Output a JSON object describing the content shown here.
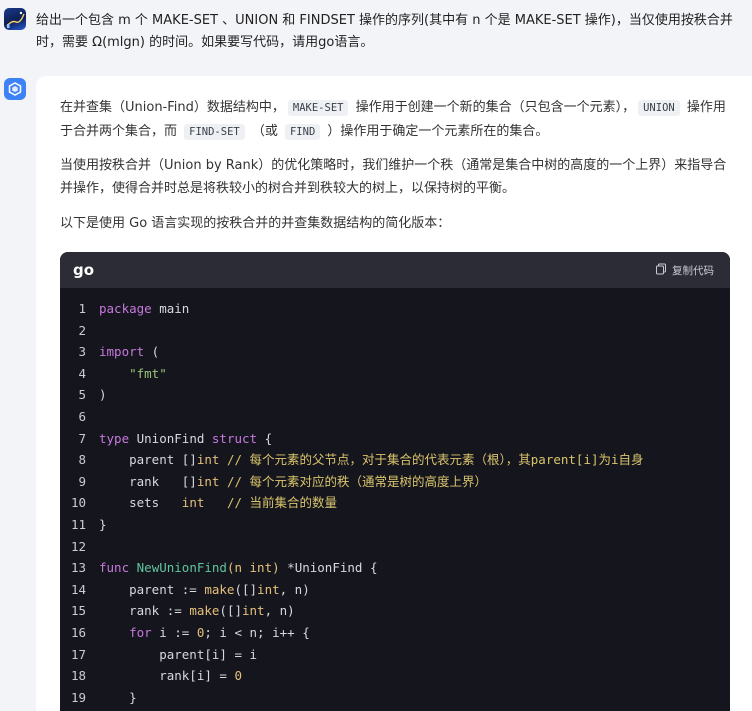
{
  "user_message": "给出一个包含 m 个 MAKE-SET 、UNION 和 FINDSET 操作的序列(其中有 n 个是 MAKE-SET 操作)，当仅使用按秩合并时，需要 Ω(mlgn) 的时间。如果要写代码，请用go语言。",
  "answer": {
    "p1": {
      "a": "在并查集（Union-Find）数据结构中，",
      "code1": "MAKE-SET",
      "b": " 操作用于创建一个新的集合（只包含一个元素），",
      "code2": "UNION",
      "c": " 操作用于合并两个集合，而 ",
      "code3": "FIND-SET",
      "d": " （或 ",
      "code4": "FIND",
      "e": " ）操作用于确定一个元素所在的集合。"
    },
    "p2": "当使用按秩合并（Union by Rank）的优化策略时，我们维护一个秩（通常是集合中树的高度的一个上界）来指导合并操作，使得合并时总是将秩较小的树合并到秩较大的树上，以保持树的平衡。",
    "p3": "以下是使用 Go 语言实现的按秩合并的并查集数据结构的简化版本：",
    "code_block": {
      "language": "go",
      "copy_label": "复制代码",
      "lines": [
        {
          "n": "1",
          "tokens": [
            [
              "kw",
              "package"
            ],
            [
              "pl",
              " main"
            ]
          ]
        },
        {
          "n": "2",
          "tokens": []
        },
        {
          "n": "3",
          "tokens": [
            [
              "kw",
              "import"
            ],
            [
              "pl",
              " ("
            ]
          ]
        },
        {
          "n": "4",
          "tokens": [
            [
              "pl",
              "    "
            ],
            [
              "st",
              "\"fmt\""
            ]
          ]
        },
        {
          "n": "5",
          "tokens": [
            [
              "pl",
              ")"
            ]
          ]
        },
        {
          "n": "6",
          "tokens": []
        },
        {
          "n": "7",
          "tokens": [
            [
              "kw",
              "type"
            ],
            [
              "pl",
              " UnionFind "
            ],
            [
              "kw",
              "struct"
            ],
            [
              "pl",
              " {"
            ]
          ]
        },
        {
          "n": "8",
          "tokens": [
            [
              "pl",
              "    parent []"
            ],
            [
              "ty",
              "int"
            ],
            [
              "cm",
              " // 每个元素的父节点，对于集合的代表元素（根），其parent[i]为i自身"
            ]
          ]
        },
        {
          "n": "9",
          "tokens": [
            [
              "pl",
              "    rank   []"
            ],
            [
              "ty",
              "int"
            ],
            [
              "cm",
              " // 每个元素对应的秩（通常是树的高度上界）"
            ]
          ]
        },
        {
          "n": "10",
          "tokens": [
            [
              "pl",
              "    sets   "
            ],
            [
              "ty",
              "int"
            ],
            [
              "cm",
              "   // 当前集合的数量"
            ]
          ]
        },
        {
          "n": "11",
          "tokens": [
            [
              "pl",
              "}"
            ]
          ]
        },
        {
          "n": "12",
          "tokens": []
        },
        {
          "n": "13",
          "tokens": [
            [
              "kw",
              "func"
            ],
            [
              "pl",
              " "
            ],
            [
              "fn",
              "NewUnionFind"
            ],
            [
              "ty",
              "(n int)"
            ],
            [
              "pl",
              " *UnionFind {"
            ]
          ]
        },
        {
          "n": "14",
          "tokens": [
            [
              "pl",
              "    parent := "
            ],
            [
              "ty",
              "make"
            ],
            [
              "pl",
              "([]"
            ],
            [
              "ty",
              "int"
            ],
            [
              "pl",
              ", n)"
            ]
          ]
        },
        {
          "n": "15",
          "tokens": [
            [
              "pl",
              "    rank := "
            ],
            [
              "ty",
              "make"
            ],
            [
              "pl",
              "([]"
            ],
            [
              "ty",
              "int"
            ],
            [
              "pl",
              ", n)"
            ]
          ]
        },
        {
          "n": "16",
          "tokens": [
            [
              "pl",
              "    "
            ],
            [
              "kw",
              "for"
            ],
            [
              "pl",
              " i := "
            ],
            [
              "nm",
              "0"
            ],
            [
              "pl",
              "; i < n; i++ {"
            ]
          ]
        },
        {
          "n": "17",
          "tokens": [
            [
              "pl",
              "        parent[i] = i"
            ]
          ]
        },
        {
          "n": "18",
          "tokens": [
            [
              "pl",
              "        rank[i] = "
            ],
            [
              "nm",
              "0"
            ]
          ]
        },
        {
          "n": "19",
          "tokens": [
            [
              "pl",
              "    }"
            ]
          ]
        }
      ]
    }
  },
  "colors": {
    "background": "#f3f4f8",
    "card": "#ffffff",
    "code_bg": "#15151d",
    "code_header": "#2b2c35",
    "ai_avatar": "#3e82f7"
  },
  "icons": [
    "user-avatar",
    "ai-logo-icon",
    "copy-icon"
  ]
}
